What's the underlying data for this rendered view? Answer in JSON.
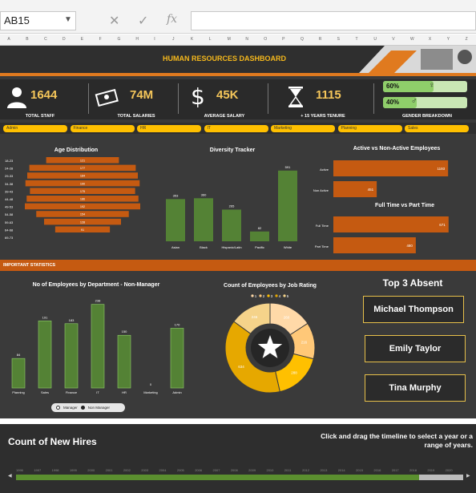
{
  "excel": {
    "name_box": "AB15",
    "cancel_icon": "x-icon",
    "enter_icon": "check-icon",
    "fx_label": "fx",
    "columns": [
      "A",
      "B",
      "C",
      "D",
      "E",
      "F",
      "G",
      "H",
      "I",
      "J",
      "K",
      "L",
      "M",
      "N",
      "O",
      "P",
      "Q",
      "R",
      "S",
      "T",
      "U",
      "V",
      "W",
      "X",
      "Y",
      "Z"
    ]
  },
  "dashboard": {
    "title": "HUMAN RESOURCES DASHBOARD"
  },
  "kpis": [
    {
      "icon": "staff-icon",
      "value": "1644",
      "label": "TOTAL STAFF"
    },
    {
      "icon": "money-icon",
      "value": "74M",
      "label": "TOTAL SALARIES"
    },
    {
      "icon": "dollar-icon",
      "value": "45K",
      "label": "AVERAGE SALARY"
    },
    {
      "icon": "hourglass-icon",
      "value": "1115",
      "label": "+ 15 YEARS TENURE"
    }
  ],
  "gender": {
    "label": "GENDER BREAKDOWN",
    "female_pct": "60%",
    "male_pct": "40%",
    "female_fraction": 0.6,
    "male_fraction": 0.4
  },
  "departments": [
    "Admin",
    "Finance",
    "HR",
    "IT",
    "Marketing",
    "Planning",
    "Sales"
  ],
  "stats_label": "IMPORTANT STATISTICS",
  "top_absent": {
    "title": "Top 3 Absent",
    "names": [
      "Michael Thompson",
      "Emily Taylor",
      "Tina Murphy"
    ]
  },
  "legend_pill": {
    "manager": "Manager",
    "non_manager": "Non Manager"
  },
  "hires": {
    "title": "Count of New Hires",
    "hint": "Click and drag the timeline to select a year or a range of years.",
    "years": [
      "1996",
      "1997",
      "1998",
      "1999",
      "2000",
      "2001",
      "2002",
      "2003",
      "2004",
      "2005",
      "2006",
      "2007",
      "2008",
      "2009",
      "2010",
      "2011",
      "2012",
      "2013",
      "2014",
      "2015",
      "2016",
      "2017",
      "2018",
      "2019",
      "2020"
    ]
  },
  "colors": {
    "orange": "#c55a11",
    "green": "#548235",
    "yellow": "#ffc000"
  },
  "chart_data": [
    {
      "type": "bar",
      "title": "Age Distribution",
      "orientation": "horizontal-funnel",
      "categories": [
        "18-23",
        "24-28",
        "29-33",
        "34-38",
        "39-43",
        "44-48",
        "49-53",
        "54-58",
        "59-63",
        "64-68",
        "69-73"
      ],
      "values": [
        121,
        177,
        184,
        190,
        175,
        186,
        192,
        154,
        128,
        91,
        0
      ]
    },
    {
      "type": "bar",
      "title": "Diversity Tracker",
      "categories": [
        "Asian",
        "Black",
        "Hispanic/Latin",
        "Pacific",
        "White"
      ],
      "values": [
        353,
        360,
        265,
        82,
        591
      ],
      "ylim": [
        0,
        650
      ]
    },
    {
      "type": "bar",
      "title": "Active vs Non-Active Employees",
      "orientation": "horizontal",
      "categories": [
        "Active",
        "Non Active"
      ],
      "values": [
        1193,
        451
      ],
      "xlim": [
        0,
        1250
      ]
    },
    {
      "type": "bar",
      "title": "Full Time vs Part Time",
      "orientation": "horizontal",
      "categories": [
        "Full Time",
        "Part Time"
      ],
      "values": [
        671,
        480
      ],
      "xlim": [
        0,
        700
      ]
    },
    {
      "type": "bar",
      "title": "No of Employees by Department - Non-Manager",
      "categories": [
        "Planning",
        "Sales",
        "Finance",
        "IT",
        "HR",
        "Marketing",
        "Admin"
      ],
      "values": [
        84,
        191,
        183,
        238,
        150,
        0,
        170
      ],
      "ylim": [
        0,
        260
      ]
    },
    {
      "type": "pie",
      "title": "Count of Employees by Job Rating",
      "legend": [
        "1",
        "2",
        "3",
        "4",
        "5"
      ],
      "categories": [
        "1",
        "2",
        "3",
        "4",
        "5"
      ],
      "values": [
        260,
        216,
        288,
        634,
        246
      ],
      "colors": [
        "#ffd9a8",
        "#ffc878",
        "#ffc000",
        "#e6a800",
        "#f5d38a"
      ]
    }
  ]
}
